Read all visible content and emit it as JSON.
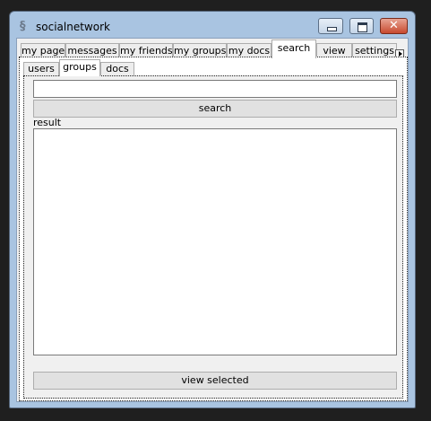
{
  "window": {
    "title": "socialnetwork",
    "app_icon": "app-icon",
    "controls": [
      "minimize-icon",
      "maximize-icon",
      "close-icon"
    ]
  },
  "tabs": {
    "items": [
      {
        "label": "my page"
      },
      {
        "label": "messages"
      },
      {
        "label": "my friends"
      },
      {
        "label": "my groups"
      },
      {
        "label": "my docs"
      },
      {
        "label": "search"
      },
      {
        "label": "view"
      },
      {
        "label": "settings"
      }
    ],
    "active": "search"
  },
  "search_tabs": {
    "items": [
      {
        "label": "users"
      },
      {
        "label": "groups"
      },
      {
        "label": "docs"
      }
    ],
    "active": "groups"
  },
  "search_panel": {
    "query_value": "",
    "search_button": "search",
    "result_label": "result",
    "results": [],
    "view_selected_button": "view selected"
  }
}
